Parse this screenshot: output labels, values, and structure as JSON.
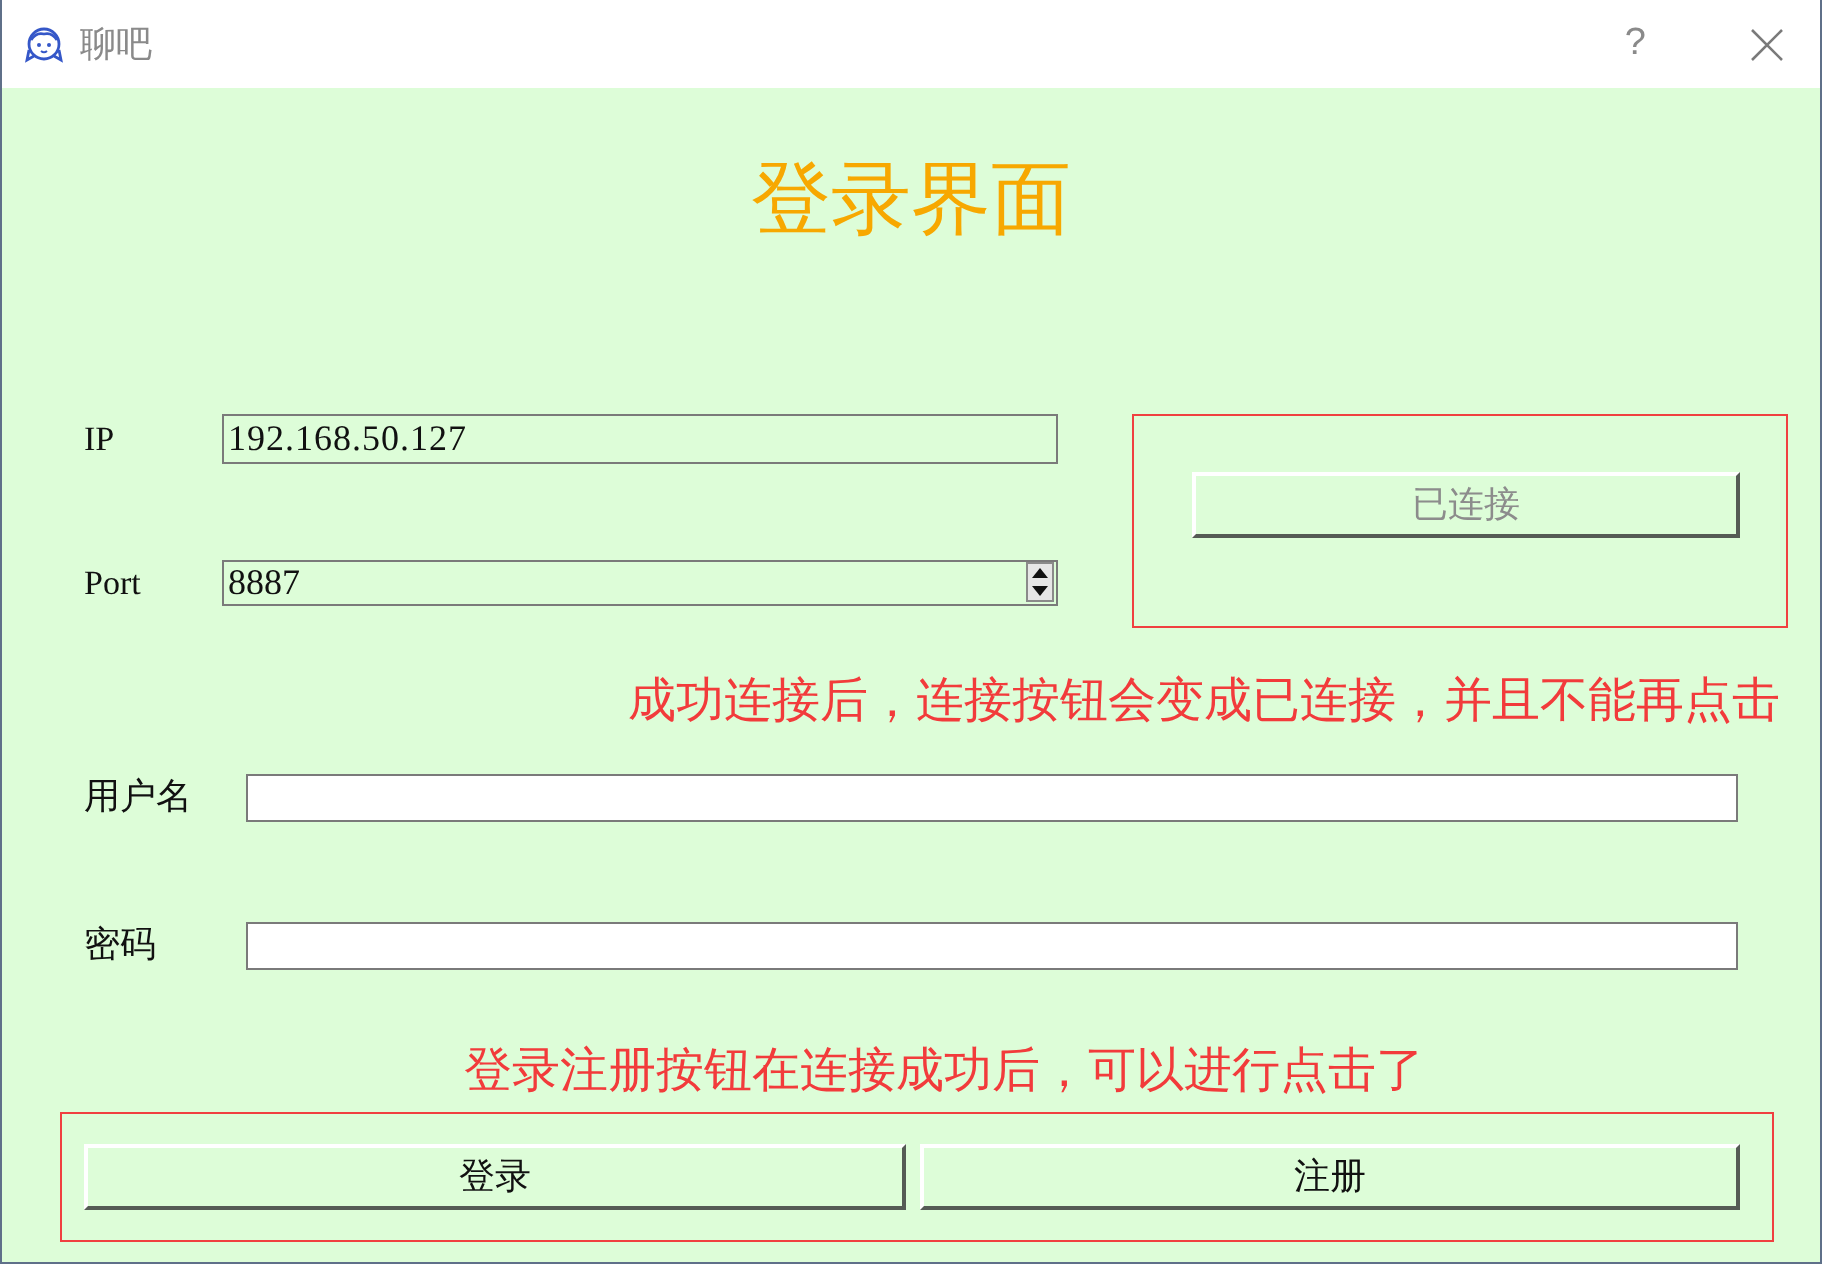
{
  "window": {
    "title": "聊吧",
    "help": "?"
  },
  "heading": "登录界面",
  "server": {
    "fields": [
      {
        "kind": "text",
        "label": "IP",
        "value": "192.168.50.127"
      },
      {
        "kind": "spin",
        "label": "Port",
        "value": "8887"
      }
    ],
    "connect_button": {
      "label": "已连接",
      "disabled": true
    }
  },
  "annotations": [
    {
      "kind": "connect-note",
      "text": "成功连接后，连接按钮会变成已连接，并且不能再点击"
    },
    {
      "kind": "buttons-note",
      "text": "登录注册按钮在连接成功后，可以进行点击了"
    }
  ],
  "account_fields": [
    {
      "label": "用户名"
    },
    {
      "label": "密码"
    }
  ],
  "buttons": [
    {
      "label": "登录",
      "disabled": false
    },
    {
      "label": "注册",
      "disabled": false
    }
  ]
}
